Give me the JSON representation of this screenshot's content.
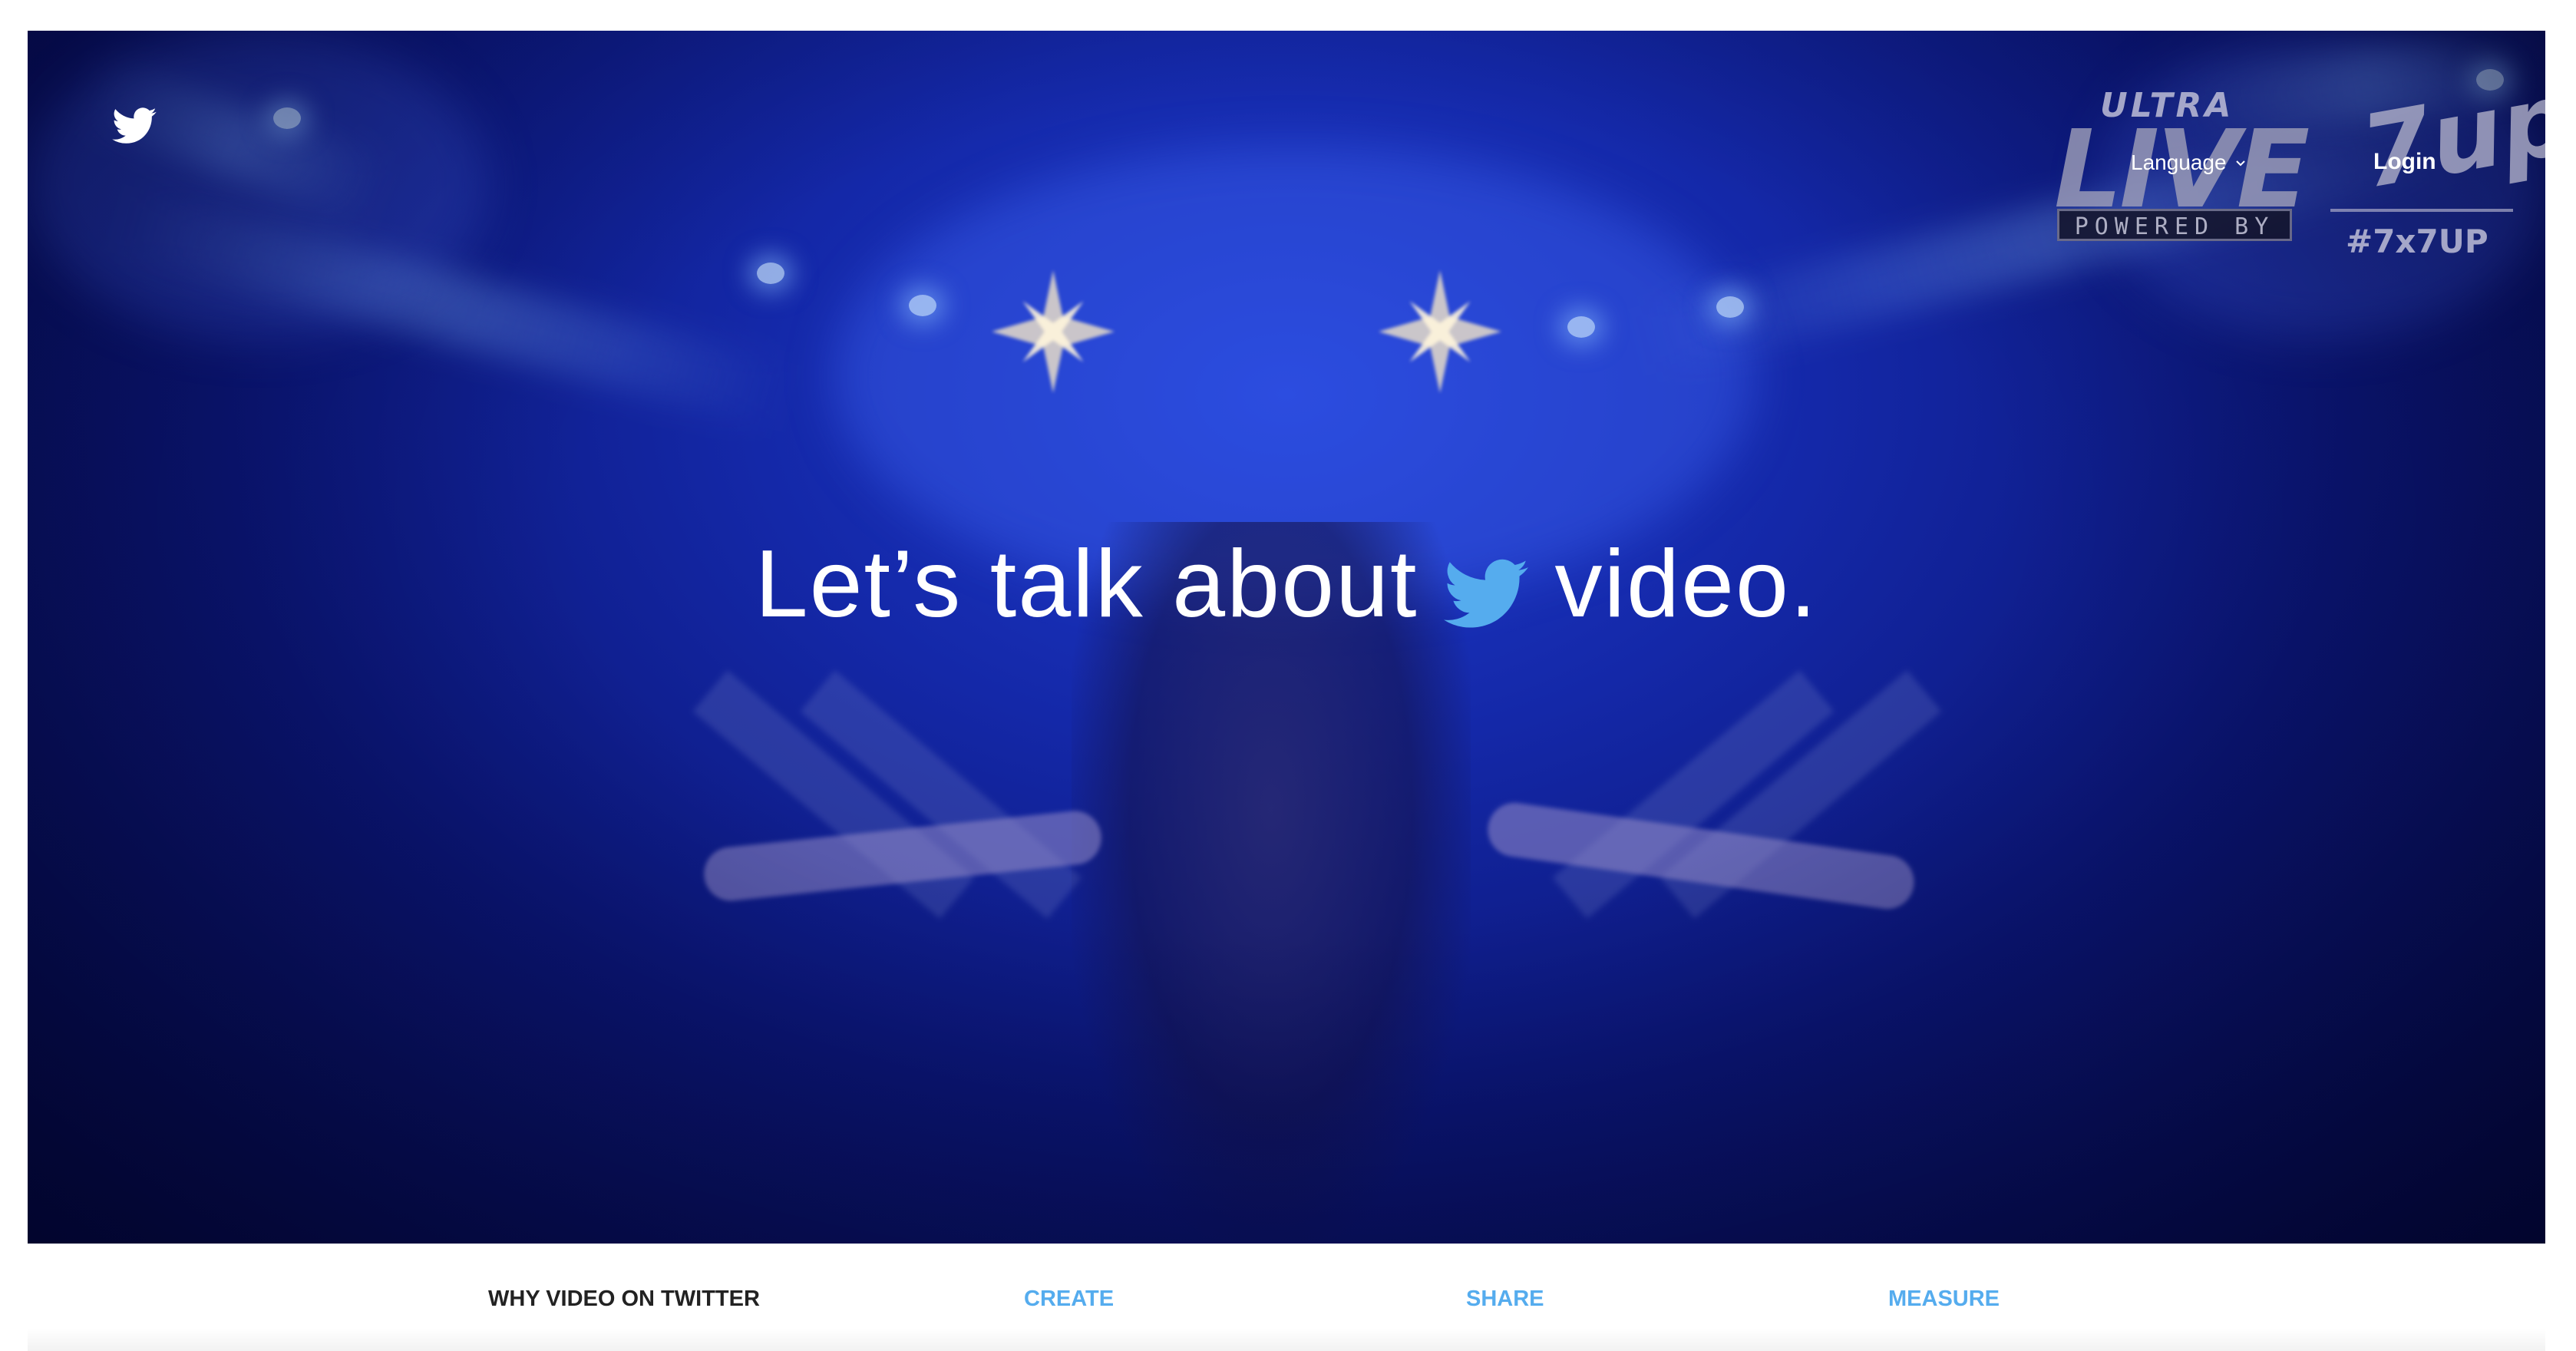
{
  "header": {
    "logo_icon": "twitter-bird-icon",
    "language_label": "Language",
    "login_label": "Login"
  },
  "video_overlay": {
    "ultra_text": "ULTRA",
    "live_text": "LIVE",
    "powered_by_text": "POWERED BY",
    "sevenup_text": "7up",
    "hashtag_text": "#7x7UP"
  },
  "hero": {
    "headline_before": "Let’s talk about",
    "headline_icon": "twitter-bird-icon",
    "headline_after": "video."
  },
  "subnav": {
    "items": [
      {
        "label": "WHY  VIDEO ON TWITTER"
      },
      {
        "label": "CREATE"
      },
      {
        "label": "SHARE"
      },
      {
        "label": "MEASURE"
      }
    ]
  },
  "colors": {
    "accent": "#55acee",
    "hero_blue": "#1428a8",
    "text_dark": "#222222"
  }
}
